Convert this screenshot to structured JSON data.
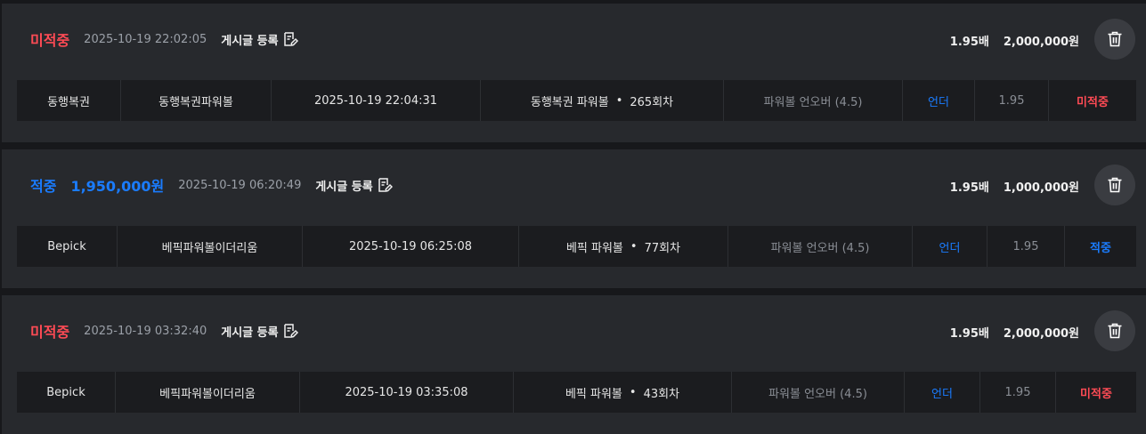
{
  "colors": {
    "hit": "#1a7cff",
    "miss": "#ff4b55",
    "card_bg": "#27292d",
    "row_bg": "#1b1c1f"
  },
  "icons": {
    "post": "edit-note-icon",
    "delete": "trash-icon"
  },
  "bets": [
    {
      "status": "미적중",
      "win_amount": "",
      "datetime": "2025-10-19 22:02:05",
      "post_label": "게시글 등록",
      "odds": "1.95배",
      "stake": "2,000,000원",
      "detail": {
        "site": "동행복권",
        "game": "동행복권파워볼",
        "time": "2025-10-19 22:04:31",
        "round_name": "동행복권 파워볼",
        "round_sep": "•",
        "round_no": "265회차",
        "market": "파워볼 언오버 (4.5)",
        "pick": "언더",
        "rate": "1.95",
        "result": "미적중"
      }
    },
    {
      "status": "적중",
      "win_amount": "1,950,000원",
      "datetime": "2025-10-19 06:20:49",
      "post_label": "게시글 등록",
      "odds": "1.95배",
      "stake": "1,000,000원",
      "detail": {
        "site": "Bepick",
        "game": "베픽파워볼이더리움",
        "time": "2025-10-19 06:25:08",
        "round_name": "베픽 파워볼",
        "round_sep": "•",
        "round_no": "77회차",
        "market": "파워볼 언오버 (4.5)",
        "pick": "언더",
        "rate": "1.95",
        "result": "적중"
      }
    },
    {
      "status": "미적중",
      "win_amount": "",
      "datetime": "2025-10-19 03:32:40",
      "post_label": "게시글 등록",
      "odds": "1.95배",
      "stake": "2,000,000원",
      "detail": {
        "site": "Bepick",
        "game": "베픽파워볼이더리움",
        "time": "2025-10-19 03:35:08",
        "round_name": "베픽 파워볼",
        "round_sep": "•",
        "round_no": "43회차",
        "market": "파워볼 언오버 (4.5)",
        "pick": "언더",
        "rate": "1.95",
        "result": "미적중"
      }
    }
  ]
}
